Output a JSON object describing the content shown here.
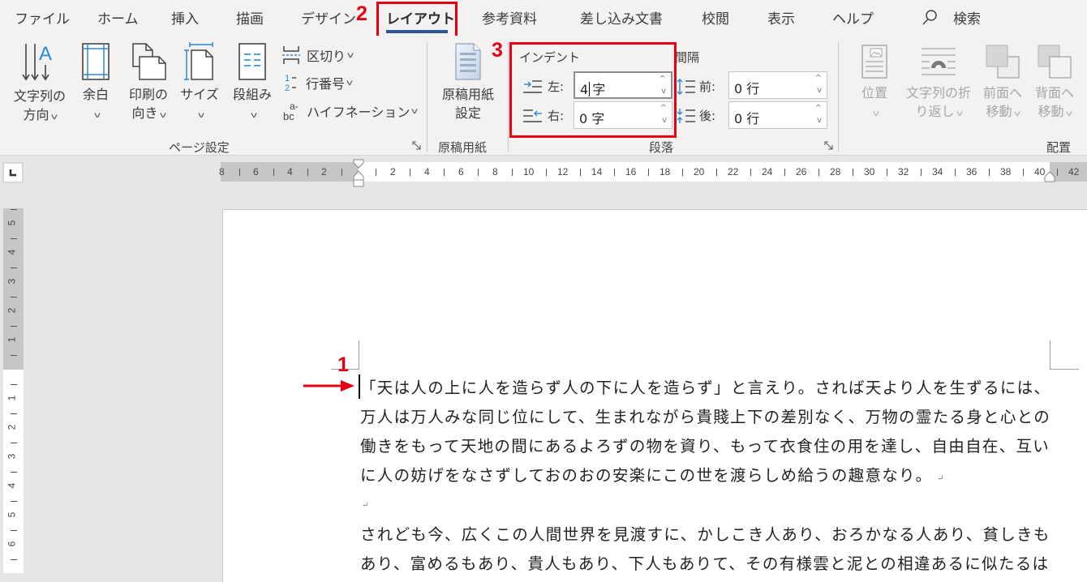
{
  "tabs": [
    {
      "label": "ファイル",
      "active": false
    },
    {
      "label": "ホーム",
      "active": false
    },
    {
      "label": "挿入",
      "active": false
    },
    {
      "label": "描画",
      "active": false
    },
    {
      "label": "デザイン",
      "active": false
    },
    {
      "label": "レイアウト",
      "active": true
    },
    {
      "label": "参考資料",
      "active": false
    },
    {
      "label": "差し込み文書",
      "active": false
    },
    {
      "label": "校閲",
      "active": false
    },
    {
      "label": "表示",
      "active": false
    },
    {
      "label": "ヘルプ",
      "active": false
    }
  ],
  "search": {
    "icon": "search-icon",
    "label": "検索"
  },
  "ribbon": {
    "page_setup": {
      "group_label": "ページ設定",
      "text_direction": {
        "line1": "文字列の",
        "line2": "方向"
      },
      "margins": {
        "line1": "余白"
      },
      "orientation": {
        "line1": "印刷の",
        "line2": "向き"
      },
      "size": {
        "line1": "サイズ"
      },
      "columns": {
        "line1": "段組み"
      },
      "breaks": "区切り",
      "line_numbers": "行番号",
      "hyphenation": "ハイフネーション"
    },
    "genko": {
      "group_label": "原稿用紙",
      "button": {
        "line1": "原稿用紙",
        "line2": "設定"
      }
    },
    "paragraph": {
      "group_label": "段落",
      "indent_heading": "インデント",
      "spacing_heading": "間隔",
      "indent_left_label": "左:",
      "indent_left_value": "4",
      "indent_left_unit": "字",
      "indent_right_label": "右:",
      "indent_right_value": "0 字",
      "spacing_before_label": "前:",
      "spacing_before_value": "0 行",
      "spacing_after_label": "後:",
      "spacing_after_value": "0 行"
    },
    "arrange": {
      "group_label": "配置",
      "position": {
        "line1": "位置"
      },
      "wrap_text": {
        "line1": "文字列の折",
        "line2": "り返し"
      },
      "bring_forward": {
        "line1": "前面へ",
        "line2": "移動"
      },
      "send_backward": {
        "line1": "背面へ",
        "line2": "移動"
      }
    }
  },
  "annotations": {
    "step1": "1",
    "step2": "2",
    "step3": "3",
    "color": "#e60012"
  },
  "ruler": {
    "left_ticks": [
      "8",
      "6",
      "4",
      "2"
    ],
    "right_ticks": [
      "2",
      "4",
      "6",
      "8",
      "10",
      "12",
      "14",
      "16",
      "18",
      "20",
      "22",
      "24",
      "26",
      "28",
      "30",
      "32",
      "34",
      "36",
      "38",
      "40",
      "42"
    ],
    "vertical_top_ticks": [
      "5",
      "4",
      "3",
      "2",
      "1"
    ],
    "vertical_bottom_ticks": [
      "1",
      "2",
      "3",
      "4",
      "5",
      "6"
    ]
  },
  "document": {
    "paragraph1": [
      "「天は人の上に人を造らず人の下に人を造らず」と言えり。されば天より人を生ずるには、",
      "万人は万人みな同じ位にして、生まれながら貴賤上下の差別なく、万物の霊たる身と心との",
      "働きをもって天地の間にあるよろずの物を資り、もって衣食住の用を達し、自由自在、互い",
      "に人の妨げをなさずしておのおの安楽にこの世を渡らしめ給うの趣意なり。"
    ],
    "paragraph_mark": "↵",
    "paragraph2": [
      "されども今、広くこの人間世界を見渡すに、かしこき人あり、おろかなる人あり、貧しきも",
      "あり、富めるもあり、貴人もあり、下人もありて、その有様雲と泥との相違あるに似たるは"
    ]
  }
}
